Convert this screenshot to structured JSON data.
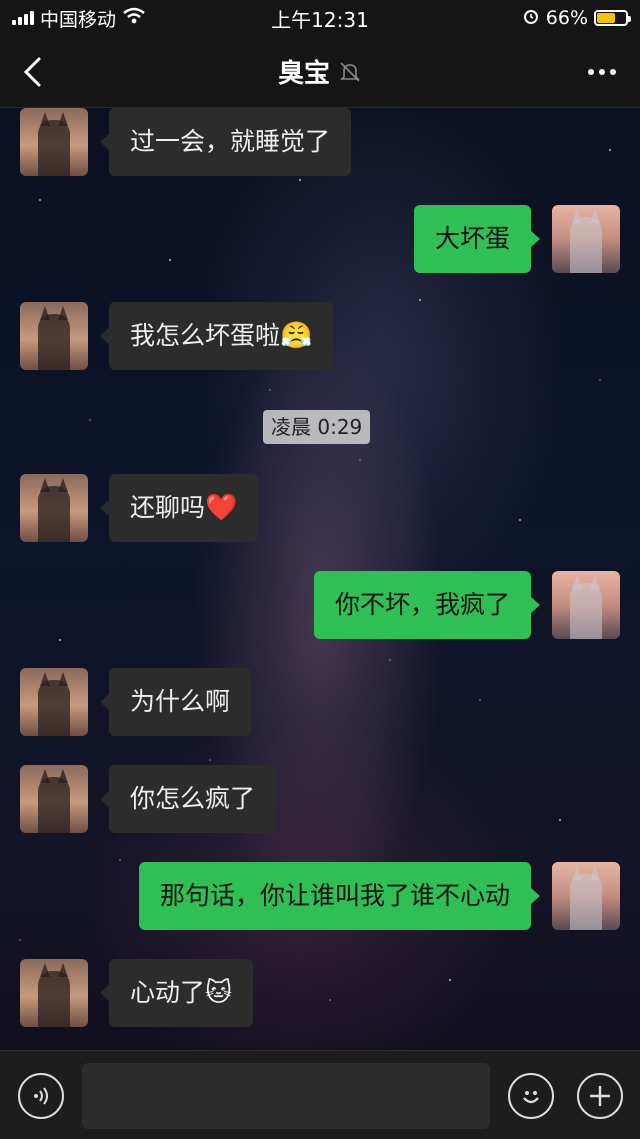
{
  "status_bar": {
    "carrier": "中国移动",
    "time": "上午12:31",
    "battery_percent": "66%",
    "battery_level": 0.66,
    "icons": [
      "signal-icon",
      "wifi-icon",
      "alarm-icon",
      "battery-charging-icon"
    ]
  },
  "header": {
    "title": "臭宝",
    "icons": [
      "back-icon",
      "mute-bell-icon",
      "more-icon"
    ]
  },
  "chat": {
    "messages": [
      {
        "side": "left",
        "text": "过一会，就睡觉了",
        "emoji": ""
      },
      {
        "side": "right",
        "text": "大坏蛋",
        "emoji": ""
      },
      {
        "side": "left",
        "text": "我怎么坏蛋啦",
        "emoji": "😤"
      },
      {
        "side": "left",
        "text": "还聊吗",
        "emoji": "❤️"
      },
      {
        "side": "right",
        "text": "你不坏，我疯了",
        "emoji": ""
      },
      {
        "side": "left",
        "text": "为什么啊",
        "emoji": ""
      },
      {
        "side": "left",
        "text": "你怎么疯了",
        "emoji": ""
      },
      {
        "side": "right",
        "text": "那句话，你让谁叫我了谁不心动",
        "emoji": ""
      },
      {
        "side": "left",
        "text": "心动了",
        "emoji": "🐱"
      }
    ],
    "timestamp": "凌晨 0:29"
  },
  "input_bar": {
    "placeholder": "",
    "icons": [
      "voice-icon",
      "emoji-face-icon",
      "plus-icon"
    ]
  },
  "colors": {
    "bubble_outgoing": "#2fbf55",
    "bubble_incoming": "#2c2c2c",
    "bars": "#151515"
  }
}
